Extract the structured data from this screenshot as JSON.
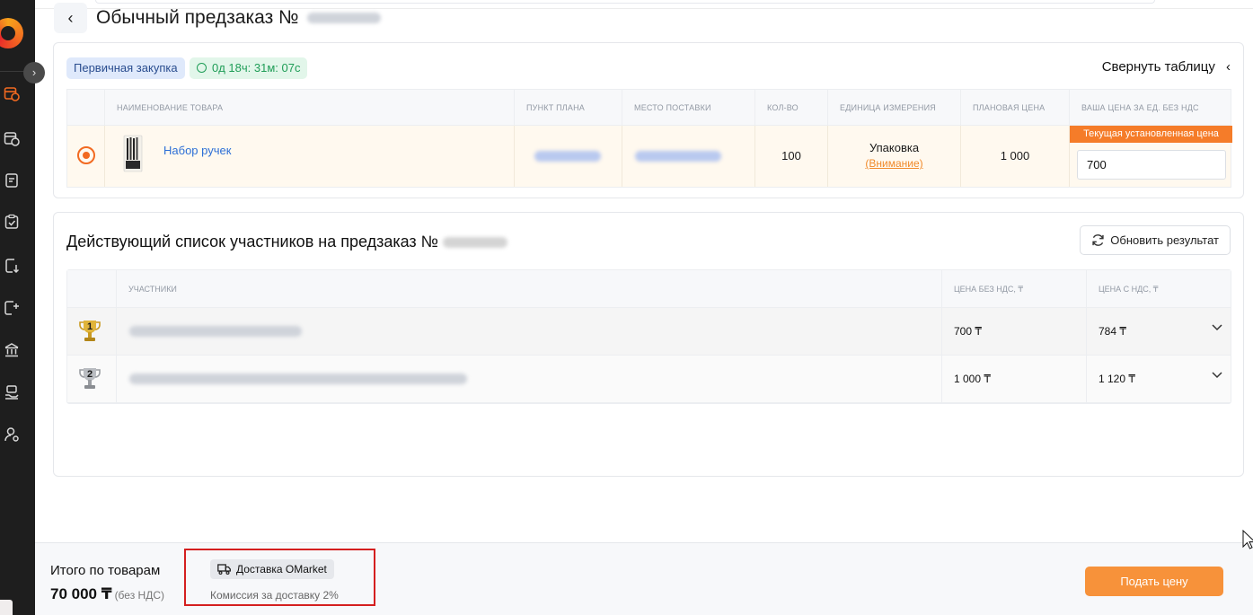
{
  "header": {
    "title": "Обычный предзаказ №",
    "back_label": "‹"
  },
  "order_card": {
    "badge_purchase": "Первичная закупка",
    "badge_timer": "0д 18ч: 31м: 07с",
    "collapse_label": "Свернуть таблицу",
    "columns": [
      "Наименование товара",
      "Пункт плана",
      "Место поставки",
      "Кол-во",
      "Единица измерения",
      "Плановая цена",
      "Ваша цена за ед. без НДС"
    ],
    "row": {
      "product_name": "Набор ручек",
      "quantity": "100",
      "unit": "Упаковка",
      "unit_note": "(Внимание)",
      "plan_price": "1 000",
      "current_price_tag": "Текущая установленная цена",
      "your_price": "700"
    }
  },
  "participants_card": {
    "title": "Действующий список участников на предзаказ №",
    "refresh_label": "Обновить результат",
    "columns": [
      "Участники",
      "Цена без НДС, ₸",
      "Цена с НДС, ₸"
    ],
    "rows": [
      {
        "rank": "1",
        "price_no_vat": "700 ₸",
        "price_vat": "784 ₸"
      },
      {
        "rank": "2",
        "price_no_vat": "1 000 ₸",
        "price_vat": "1 120 ₸"
      }
    ]
  },
  "footer": {
    "label": "Итого по товарам",
    "total": "70 000 ₸",
    "total_note": "(без НДС)",
    "delivery_label": "Доставка OMarket",
    "delivery_fee": "Комиссия за доставку 2%",
    "submit_label": "Подать цену"
  },
  "colors": {
    "accent": "#f26a21",
    "submit": "#f7923a",
    "link": "#2d6fd6",
    "timer_green": "#1f9d57",
    "highlight_box": "#d41f1f"
  }
}
